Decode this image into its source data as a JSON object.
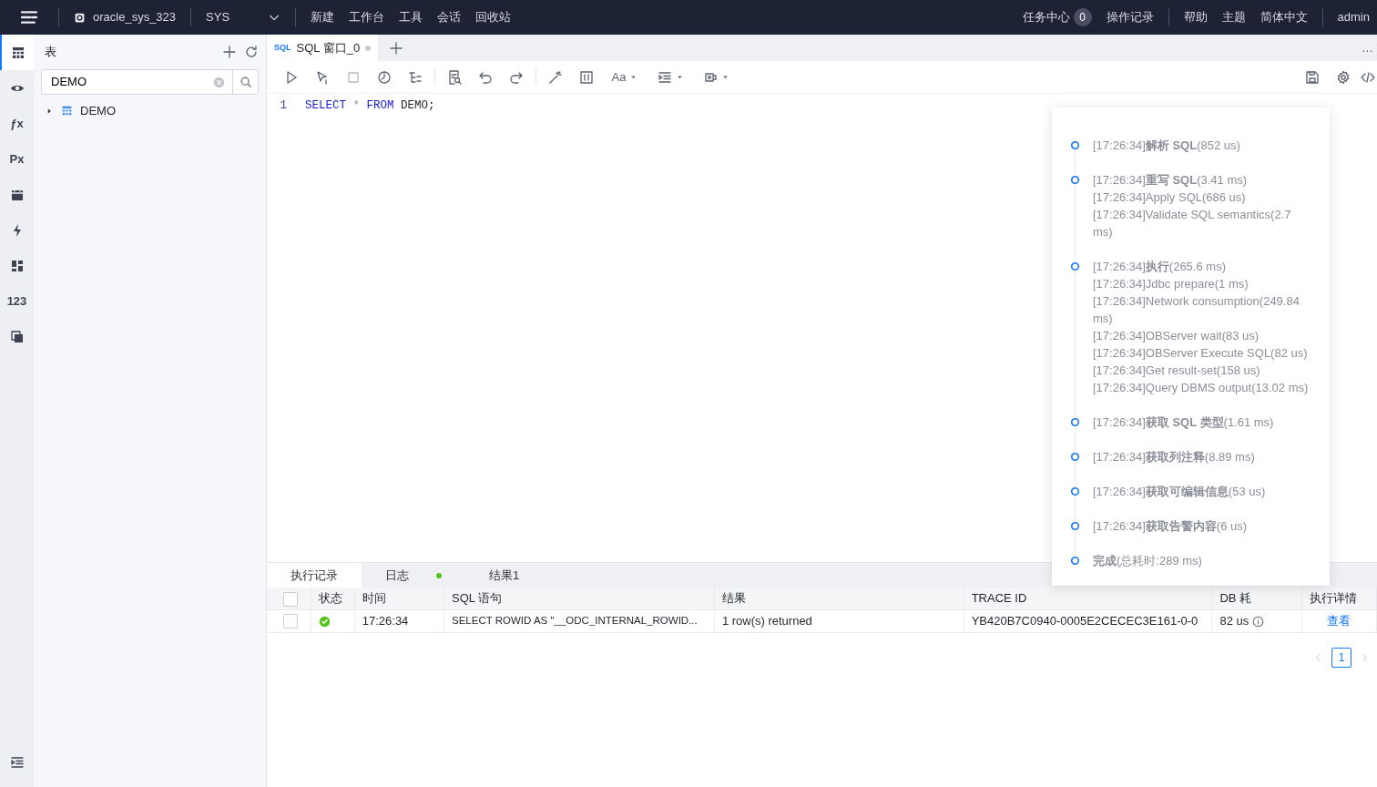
{
  "topbar": {
    "datasource": "oracle_sys_323",
    "schema": "SYS",
    "menu": [
      "新建",
      "工作台",
      "工具",
      "会话",
      "回收站"
    ],
    "task_center": "任务中心",
    "task_count": "0",
    "right_links": [
      "操作记录",
      "帮助",
      "主题",
      "简体中文"
    ],
    "user": "admin"
  },
  "rail": [
    {
      "selected": true
    },
    {
      "selected": false
    },
    {
      "label": "ƒx",
      "selected": false
    },
    {
      "label": "Px",
      "selected": false
    },
    {
      "selected": false
    },
    {
      "selected": false
    },
    {
      "selected": false
    },
    {
      "label": "123",
      "selected": false
    },
    {
      "selected": false
    }
  ],
  "sidebar": {
    "title": "表",
    "search": {
      "value": "DEMO"
    },
    "tree": [
      {
        "label": "DEMO",
        "expanded": false
      }
    ]
  },
  "editor_tabs": [
    {
      "icon_text": "SQL",
      "label": "SQL 窗口_0",
      "selected": true,
      "unsaved": true
    }
  ],
  "editor_more": "…",
  "toolbar": {
    "font_button": "Aa"
  },
  "editor": {
    "lines": [
      {
        "number": "1",
        "tokens": [
          {
            "text": "SELECT",
            "kind": "keyword"
          },
          {
            "text": "*",
            "kind": "operator"
          },
          {
            "text": "FROM",
            "kind": "keyword"
          },
          {
            "text": "DEMO;",
            "kind": "plain"
          }
        ]
      }
    ]
  },
  "bottom_tabs": [
    {
      "label": "执行记录",
      "selected": true,
      "indicator": false
    },
    {
      "label": "日志",
      "selected": false,
      "indicator": true
    },
    {
      "label": "结果1",
      "selected": false,
      "indicator": false
    }
  ],
  "table": {
    "select_all_checked": false,
    "columns": [
      "状态",
      "时间",
      "SQL 语句",
      "结果",
      "TRACE ID",
      "DB 耗",
      "执行详情"
    ],
    "rows": [
      {
        "checked": false,
        "succeeded": true,
        "time": "17:26:34",
        "sql": "SELECT ROWID AS \"__ODC_INTERNAL_ROWID...",
        "result": "1 row(s) returned",
        "trace_id": "YB420B7C0940-0005E2CECEC3E161-0-0",
        "db_time": "82 us",
        "action": "查看"
      }
    ]
  },
  "pagination": {
    "pages": [
      {
        "label": "1",
        "selected": true
      }
    ]
  },
  "timeline": [
    {
      "head": "[17:26:34]**解析 SQL**(852 us)"
    },
    {
      "head": "[17:26:34]**重写 SQL**(3.41 ms)",
      "details": [
        "[17:26:34]Apply SQL(686 us)",
        "[17:26:34]Validate SQL semantics(2.7 ms)"
      ]
    },
    {
      "head": "[17:26:34]**执行**(265.6 ms)",
      "details": [
        "[17:26:34]Jdbc prepare(1 ms)",
        "[17:26:34]Network consumption(249.84 ms)",
        "[17:26:34]OBServer wait(83 us)",
        "[17:26:34]OBServer Execute SQL(82 us)",
        "[17:26:34]Get result-set(158 us)",
        "[17:26:34]Query DBMS output(13.02 ms)"
      ]
    },
    {
      "head": "[17:26:34]**获取 SQL 类型**(1.61 ms)"
    },
    {
      "head": "[17:26:34]**获取列注释**(8.89 ms)"
    },
    {
      "head": "[17:26:34]**获取可编辑信息**(53 us)"
    },
    {
      "head": "[17:26:34]**获取告警内容**(6 us)"
    },
    {
      "head": "**完成**(总耗时:289 ms)"
    }
  ]
}
